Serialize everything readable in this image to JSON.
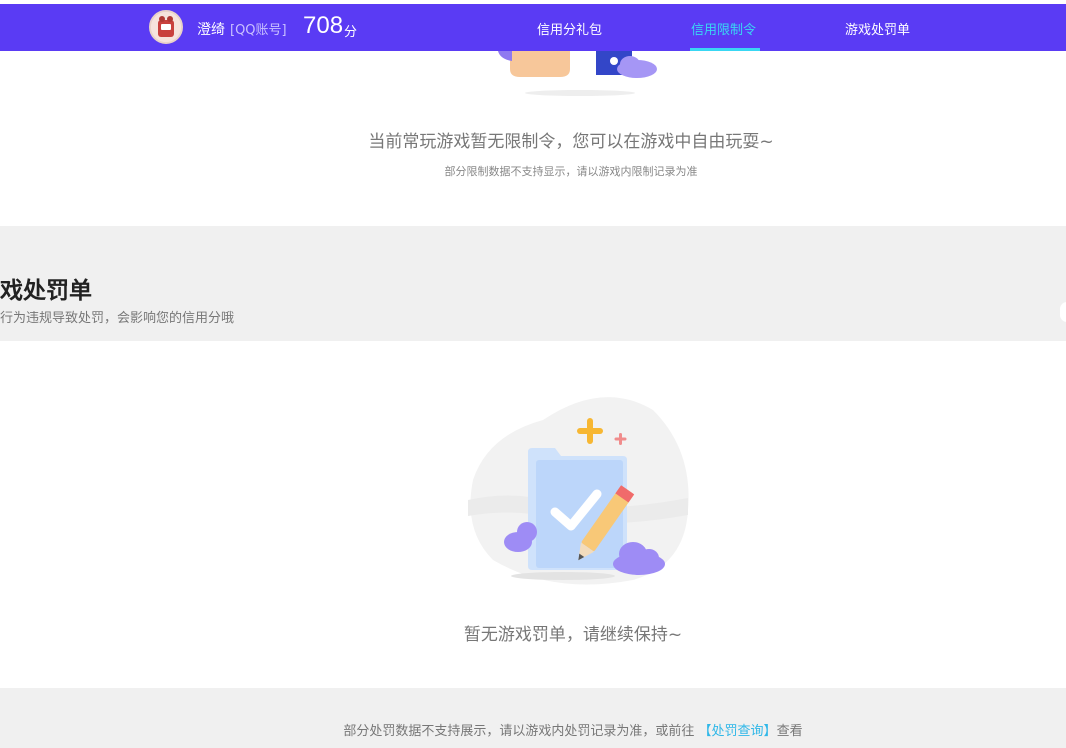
{
  "header": {
    "username": "澄绮",
    "account_type": "[QQ账号]",
    "score": "708",
    "score_unit": "分",
    "nav": [
      {
        "label": "信用分礼包",
        "active": false
      },
      {
        "label": "信用限制令",
        "active": true
      },
      {
        "label": "游戏处罚单",
        "active": false
      }
    ]
  },
  "restriction": {
    "message": "当前常玩游戏暂无限制令，您可以在游戏中自由玩耍~",
    "note": "部分限制数据不支持显示，请以游戏内限制记录为准"
  },
  "penalty": {
    "title": "戏处罚单",
    "subtitle": "行为违规导致处罚，会影响您的信用分哦",
    "empty_message": "暂无游戏罚单，请继续保持~"
  },
  "footer": {
    "text_before": "部分处罚数据不支持展示，请以游戏内处罚记录为准，或前往 ",
    "link": "【处罚查询】",
    "text_after": "查看"
  },
  "colors": {
    "nav_bg": "#5a3bf4",
    "nav_active": "#39d7f3",
    "link": "#2fb7e8"
  }
}
